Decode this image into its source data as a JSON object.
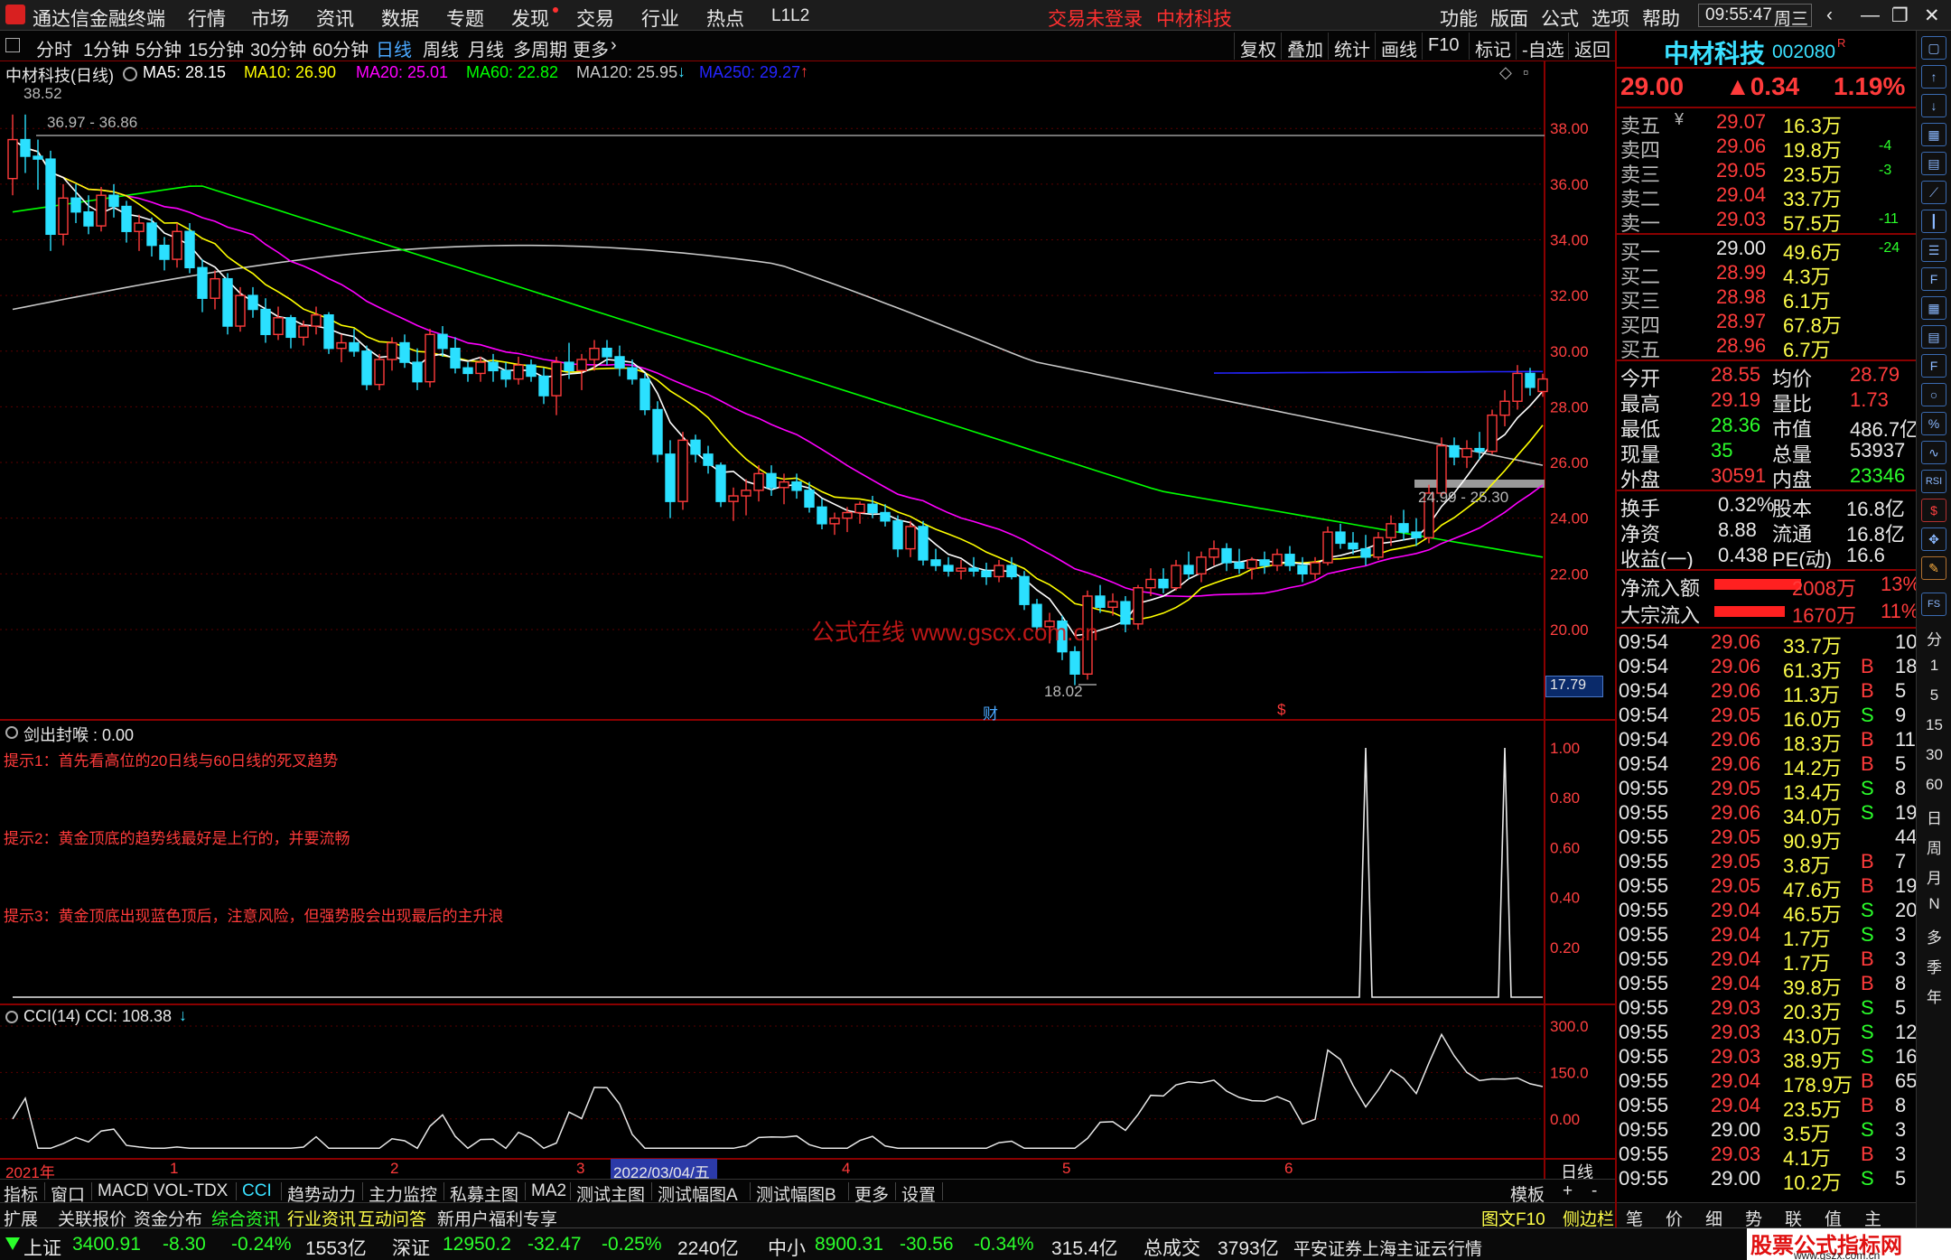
{
  "titlebar": {
    "app_title": "通达信金融终端",
    "menu": [
      "行情",
      "市场",
      "资讯",
      "数据",
      "专题",
      "发现",
      "交易",
      "行业",
      "热点",
      "L1L2"
    ],
    "login_status": "交易未登录",
    "stock_name": "中材科技",
    "right_menu": [
      "功能",
      "版面",
      "公式",
      "选项",
      "帮助"
    ],
    "clock": "09:55:47",
    "weekday": "周三"
  },
  "period_bar": {
    "items": [
      "分时",
      "1分钟",
      "5分钟",
      "15分钟",
      "30分钟",
      "60分钟",
      "日线",
      "周线",
      "月线",
      "多周期",
      "更多"
    ],
    "selected": "日线",
    "right_buttons": [
      "复权",
      "叠加",
      "统计",
      "画线",
      "F10",
      "标记",
      "-自选",
      "返回"
    ]
  },
  "main_chart": {
    "title": "中材科技(日线)",
    "ma_labels": [
      {
        "text": "MA5: 28.15",
        "color": "#ffffff"
      },
      {
        "text": "MA10: 26.90",
        "color": "#ffff00"
      },
      {
        "text": "MA20: 25.01",
        "color": "#ff00ff"
      },
      {
        "text": "MA60: 22.82",
        "color": "#00ff00"
      },
      {
        "text": "MA120: 25.95",
        "color": "#c8c8c8"
      },
      {
        "text": "MA250: 29.27",
        "color": "#2424ff"
      }
    ],
    "ma120_arrow": "↓",
    "ma250_arrow": "↑",
    "high_label": "38.52",
    "range_label_top": "36.97 - 36.86",
    "range_label_right": "24.99 - 25.30",
    "low_label": "18.02",
    "current_price_box": "17.79",
    "watermark": "公式在线 www.gscx.com.cn",
    "marker_cai": "财",
    "marker_dollar": "$",
    "y_ticks": [
      "38.00",
      "36.00",
      "34.00",
      "32.00",
      "30.00",
      "28.00",
      "26.00",
      "24.00",
      "22.00",
      "20.00"
    ]
  },
  "indicator1": {
    "title": "剑出封喉 : 0.00",
    "hints": [
      "提示1：首先看高位的20日线与60日线的死叉趋势",
      "提示2：黄金顶底的趋势线最好是上行的，并要流畅",
      "提示3：黄金顶底出现蓝色顶后，注意风险，但强势股会出现最后的主升浪"
    ],
    "y_ticks": [
      "1.00",
      "0.80",
      "0.60",
      "0.40",
      "0.20"
    ]
  },
  "indicator2": {
    "title": "CCI(14)  CCI: 108.38",
    "arrow": "↓",
    "y_ticks": [
      "300.0",
      "150.0",
      "0.00"
    ]
  },
  "x_axis": {
    "labels": [
      "2021年",
      "1",
      "2",
      "3",
      "2022/03/04/五",
      "4",
      "5",
      "6"
    ],
    "period": "日线"
  },
  "tabbar": {
    "tabs": [
      "指标",
      "窗口",
      "MACD",
      "VOL-TDX",
      "CCI",
      "趋势动力",
      "主力监控",
      "私募主图",
      "MA2",
      "测试主图",
      "测试幅图A",
      "测试幅图B",
      "更多",
      "设置"
    ],
    "right": [
      "模板",
      "+",
      "-"
    ]
  },
  "extbar": {
    "items": [
      "扩展",
      "关联报价",
      "资金分布",
      "综合资讯",
      "行业资讯",
      "互动问答",
      "新用户福利专享"
    ],
    "right_items": [
      "图文F10",
      "侧边栏",
      "笔",
      "价",
      "细",
      "势",
      "联",
      "值",
      "主"
    ]
  },
  "quote": {
    "name": "中材科技",
    "code": "002080",
    "code_mark": "R",
    "price": "29.00",
    "change": "▲0.34",
    "change_pct": "1.19%",
    "asks": [
      {
        "label": "卖五",
        "price": "29.07",
        "vol": "16.3万",
        "delta": ""
      },
      {
        "label": "卖四",
        "price": "29.06",
        "vol": "19.8万",
        "delta": "-4"
      },
      {
        "label": "卖三",
        "price": "29.05",
        "vol": "23.5万",
        "delta": "-3"
      },
      {
        "label": "卖二",
        "price": "29.04",
        "vol": "33.7万",
        "delta": ""
      },
      {
        "label": "卖一",
        "price": "29.03",
        "vol": "57.5万",
        "delta": "-11"
      }
    ],
    "bids": [
      {
        "label": "买一",
        "price": "29.00",
        "vol": "49.6万",
        "delta": "-24"
      },
      {
        "label": "买二",
        "price": "28.99",
        "vol": "4.3万",
        "delta": ""
      },
      {
        "label": "买三",
        "price": "28.98",
        "vol": "6.1万",
        "delta": ""
      },
      {
        "label": "买四",
        "price": "28.97",
        "vol": "67.8万",
        "delta": ""
      },
      {
        "label": "买五",
        "price": "28.96",
        "vol": "6.7万",
        "delta": ""
      }
    ],
    "stats": [
      {
        "l1": "今开",
        "v1": "28.55",
        "c1": "red",
        "l2": "均价",
        "v2": "28.79",
        "c2": "red"
      },
      {
        "l1": "最高",
        "v1": "29.19",
        "c1": "red",
        "l2": "量比",
        "v2": "1.73",
        "c2": "red"
      },
      {
        "l1": "最低",
        "v1": "28.36",
        "c1": "grn",
        "l2": "市值",
        "v2": "486.7亿",
        "c2": "wht"
      },
      {
        "l1": "现量",
        "v1": "35",
        "c1": "grn",
        "l2": "总量",
        "v2": "53937",
        "c2": "wht"
      },
      {
        "l1": "外盘",
        "v1": "30591",
        "c1": "red",
        "l2": "内盘",
        "v2": "23346",
        "c2": "grn"
      }
    ],
    "stats2": [
      {
        "l1": "换手",
        "v1": "0.32%",
        "l2": "股本",
        "v2": "16.8亿"
      },
      {
        "l1": "净资",
        "v1": "8.88",
        "l2": "流通",
        "v2": "16.8亿"
      },
      {
        "l1": "收益(一)",
        "v1": "0.438",
        "l2": "PE(动)",
        "v2": "16.6"
      }
    ],
    "flows": [
      {
        "label": "净流入额",
        "value": "2008万",
        "pct": "13%"
      },
      {
        "label": "大宗流入",
        "value": "1670万",
        "pct": "11%"
      }
    ],
    "ticks": [
      {
        "t": "09:54",
        "p": "29.06",
        "v": "33.7万",
        "d": "",
        "n": "10"
      },
      {
        "t": "09:54",
        "p": "29.06",
        "v": "61.3万",
        "d": "B",
        "n": "18"
      },
      {
        "t": "09:54",
        "p": "29.06",
        "v": "11.3万",
        "d": "B",
        "n": "5"
      },
      {
        "t": "09:54",
        "p": "29.05",
        "v": "16.0万",
        "d": "S",
        "n": "9"
      },
      {
        "t": "09:54",
        "p": "29.06",
        "v": "18.3万",
        "d": "B",
        "n": "11"
      },
      {
        "t": "09:54",
        "p": "29.06",
        "v": "14.2万",
        "d": "B",
        "n": "5"
      },
      {
        "t": "09:55",
        "p": "29.05",
        "v": "13.4万",
        "d": "S",
        "n": "8"
      },
      {
        "t": "09:55",
        "p": "29.06",
        "v": "34.0万",
        "d": "S",
        "n": "19"
      },
      {
        "t": "09:55",
        "p": "29.05",
        "v": "90.9万",
        "d": "",
        "n": "44"
      },
      {
        "t": "09:55",
        "p": "29.05",
        "v": "3.8万",
        "d": "B",
        "n": "7"
      },
      {
        "t": "09:55",
        "p": "29.05",
        "v": "47.6万",
        "d": "B",
        "n": "19"
      },
      {
        "t": "09:55",
        "p": "29.04",
        "v": "46.5万",
        "d": "S",
        "n": "20"
      },
      {
        "t": "09:55",
        "p": "29.04",
        "v": "1.7万",
        "d": "S",
        "n": "3"
      },
      {
        "t": "09:55",
        "p": "29.04",
        "v": "1.7万",
        "d": "B",
        "n": "3"
      },
      {
        "t": "09:55",
        "p": "29.04",
        "v": "39.8万",
        "d": "B",
        "n": "8"
      },
      {
        "t": "09:55",
        "p": "29.03",
        "v": "20.3万",
        "d": "S",
        "n": "5"
      },
      {
        "t": "09:55",
        "p": "29.03",
        "v": "43.0万",
        "d": "S",
        "n": "12"
      },
      {
        "t": "09:55",
        "p": "29.03",
        "v": "38.9万",
        "d": "S",
        "n": "16"
      },
      {
        "t": "09:55",
        "p": "29.04",
        "v": "178.9万",
        "d": "B",
        "n": "65"
      },
      {
        "t": "09:55",
        "p": "29.04",
        "v": "23.5万",
        "d": "B",
        "n": "8"
      },
      {
        "t": "09:55",
        "p": "29.00",
        "v": "3.5万",
        "d": "S",
        "n": "3"
      },
      {
        "t": "09:55",
        "p": "29.03",
        "v": "4.1万",
        "d": "B",
        "n": "3"
      },
      {
        "t": "09:55",
        "p": "29.00",
        "v": "10.2万",
        "d": "S",
        "n": "5"
      }
    ]
  },
  "sidebar": {
    "text_items": [
      "分",
      "1",
      "5",
      "15",
      "30",
      "60",
      "日",
      "周",
      "月",
      "N",
      "多",
      "季",
      "年"
    ]
  },
  "statusbar": {
    "sh_label": "上证",
    "sh_val": "3400.91",
    "sh_chg": "-8.30",
    "sh_pct": "-0.24%",
    "sh_amt": "1553亿",
    "sz_label": "深证",
    "sz_val": "12950.2",
    "sz_chg": "-32.47",
    "sz_pct": "-0.25%",
    "sz_amt": "2240亿",
    "zx_label": "中小",
    "zx_val": "8900.31",
    "zx_chg": "-30.56",
    "zx_pct": "-0.34%",
    "zx_amt": "315.4亿",
    "total_label": "总成交",
    "total_amt": "3793亿",
    "broker": "平安证券上海主证云行情",
    "logo_text": "股票公式指标网",
    "logo_url": "www.gszx.com.cn"
  },
  "chart_data": {
    "type": "candlestick",
    "title": "中材科技(日线)",
    "ylim": [
      17.5,
      39.5
    ],
    "candles": [
      [
        36.2,
        38.5,
        35.6,
        37.6
      ],
      [
        37.6,
        38.5,
        36.4,
        37.0
      ],
      [
        37.0,
        37.6,
        35.8,
        36.9
      ],
      [
        36.9,
        37.2,
        33.6,
        34.2
      ],
      [
        34.2,
        36.0,
        33.8,
        35.5
      ],
      [
        35.5,
        36.0,
        34.6,
        35.0
      ],
      [
        35.0,
        35.6,
        34.2,
        34.5
      ],
      [
        34.5,
        35.9,
        34.3,
        35.6
      ],
      [
        35.6,
        36.0,
        34.8,
        35.2
      ],
      [
        35.2,
        35.4,
        33.9,
        34.3
      ],
      [
        34.3,
        34.9,
        33.6,
        34.6
      ],
      [
        34.6,
        34.8,
        33.4,
        33.8
      ],
      [
        33.8,
        34.1,
        32.9,
        33.3
      ],
      [
        33.3,
        34.6,
        33.0,
        34.3
      ],
      [
        34.3,
        34.6,
        32.8,
        33.0
      ],
      [
        33.0,
        33.3,
        31.4,
        31.9
      ],
      [
        31.9,
        32.9,
        31.5,
        32.6
      ],
      [
        32.6,
        32.8,
        30.6,
        30.9
      ],
      [
        30.9,
        32.3,
        30.7,
        32.0
      ],
      [
        32.0,
        32.3,
        31.2,
        31.5
      ],
      [
        31.5,
        31.9,
        30.3,
        30.6
      ],
      [
        30.6,
        31.6,
        30.4,
        31.2
      ],
      [
        31.2,
        31.3,
        30.1,
        30.5
      ],
      [
        30.5,
        31.1,
        30.2,
        30.9
      ],
      [
        30.9,
        31.6,
        30.6,
        31.3
      ],
      [
        31.3,
        31.4,
        29.9,
        30.1
      ],
      [
        30.1,
        30.6,
        29.6,
        30.3
      ],
      [
        30.3,
        30.8,
        29.8,
        30.0
      ],
      [
        30.0,
        30.2,
        28.6,
        28.8
      ],
      [
        28.8,
        29.9,
        28.6,
        29.7
      ],
      [
        29.7,
        30.5,
        29.3,
        30.3
      ],
      [
        30.3,
        30.6,
        29.4,
        29.6
      ],
      [
        29.6,
        30.1,
        28.6,
        28.9
      ],
      [
        28.9,
        30.8,
        28.7,
        30.6
      ],
      [
        30.6,
        30.9,
        29.8,
        30.1
      ],
      [
        30.1,
        30.5,
        29.2,
        29.4
      ],
      [
        29.4,
        29.6,
        28.9,
        29.2
      ],
      [
        29.2,
        29.8,
        28.9,
        29.6
      ],
      [
        29.6,
        29.9,
        28.9,
        29.3
      ],
      [
        29.3,
        29.6,
        28.7,
        29.0
      ],
      [
        29.0,
        29.8,
        28.8,
        29.5
      ],
      [
        29.5,
        29.7,
        28.9,
        29.1
      ],
      [
        29.1,
        29.4,
        28.1,
        28.4
      ],
      [
        28.4,
        29.8,
        27.7,
        29.6
      ],
      [
        29.6,
        30.3,
        29.0,
        29.3
      ],
      [
        29.3,
        29.9,
        28.6,
        29.7
      ],
      [
        29.7,
        30.4,
        29.3,
        30.1
      ],
      [
        30.1,
        30.4,
        29.5,
        29.8
      ],
      [
        29.8,
        30.2,
        29.1,
        29.4
      ],
      [
        29.4,
        29.7,
        28.8,
        29.0
      ],
      [
        29.0,
        29.2,
        27.7,
        27.9
      ],
      [
        27.9,
        28.2,
        26.0,
        26.3
      ],
      [
        26.3,
        26.8,
        24.0,
        24.6
      ],
      [
        24.6,
        27.1,
        24.3,
        26.8
      ],
      [
        26.8,
        27.0,
        26.0,
        26.3
      ],
      [
        26.3,
        26.6,
        25.6,
        25.9
      ],
      [
        25.9,
        26.0,
        24.4,
        24.6
      ],
      [
        24.6,
        25.1,
        23.9,
        24.8
      ],
      [
        24.8,
        25.4,
        24.1,
        25.0
      ],
      [
        25.0,
        25.9,
        24.6,
        25.6
      ],
      [
        25.6,
        25.9,
        24.8,
        25.1
      ],
      [
        25.1,
        25.6,
        24.5,
        25.3
      ],
      [
        25.3,
        25.6,
        24.7,
        25.0
      ],
      [
        25.0,
        25.3,
        24.2,
        24.4
      ],
      [
        24.4,
        24.7,
        23.6,
        23.8
      ],
      [
        23.8,
        24.2,
        23.4,
        24.0
      ],
      [
        24.0,
        24.4,
        23.5,
        24.2
      ],
      [
        24.2,
        24.6,
        23.8,
        24.5
      ],
      [
        24.5,
        24.8,
        24.0,
        24.2
      ],
      [
        24.2,
        24.5,
        23.7,
        23.9
      ],
      [
        23.9,
        24.1,
        22.6,
        22.9
      ],
      [
        22.9,
        23.9,
        22.6,
        23.7
      ],
      [
        23.7,
        23.9,
        22.3,
        22.5
      ],
      [
        22.5,
        22.9,
        22.1,
        22.3
      ],
      [
        22.3,
        22.6,
        21.9,
        22.1
      ],
      [
        22.1,
        22.5,
        21.8,
        22.2
      ],
      [
        22.2,
        22.6,
        21.9,
        22.1
      ],
      [
        22.1,
        22.4,
        21.6,
        21.9
      ],
      [
        21.9,
        22.5,
        21.7,
        22.3
      ],
      [
        22.3,
        22.6,
        21.8,
        21.9
      ],
      [
        21.9,
        22.1,
        20.7,
        20.9
      ],
      [
        20.9,
        21.1,
        19.9,
        20.1
      ],
      [
        20.1,
        20.6,
        19.5,
        20.3
      ],
      [
        20.3,
        20.5,
        18.9,
        19.2
      ],
      [
        19.2,
        19.4,
        18.0,
        18.4
      ],
      [
        18.4,
        21.4,
        18.2,
        21.2
      ],
      [
        21.2,
        21.6,
        20.6,
        20.8
      ],
      [
        20.8,
        21.3,
        20.5,
        21.0
      ],
      [
        21.0,
        21.2,
        19.9,
        20.2
      ],
      [
        20.2,
        21.6,
        20.0,
        21.5
      ],
      [
        21.5,
        22.2,
        21.2,
        21.8
      ],
      [
        21.8,
        22.2,
        21.3,
        21.5
      ],
      [
        21.5,
        22.5,
        21.4,
        22.3
      ],
      [
        22.3,
        22.8,
        21.8,
        22.0
      ],
      [
        22.0,
        22.8,
        21.7,
        22.6
      ],
      [
        22.6,
        23.2,
        22.3,
        22.9
      ],
      [
        22.9,
        23.1,
        22.1,
        22.4
      ],
      [
        22.4,
        22.9,
        22.0,
        22.2
      ],
      [
        22.2,
        22.6,
        21.8,
        22.5
      ],
      [
        22.5,
        22.8,
        22.0,
        22.3
      ],
      [
        22.3,
        22.9,
        22.1,
        22.7
      ],
      [
        22.7,
        23.0,
        22.1,
        22.3
      ],
      [
        22.3,
        22.6,
        21.7,
        22.0
      ],
      [
        22.0,
        22.6,
        21.8,
        22.4
      ],
      [
        22.4,
        23.7,
        22.3,
        23.5
      ],
      [
        23.5,
        23.8,
        22.9,
        23.1
      ],
      [
        23.1,
        23.5,
        22.7,
        22.9
      ],
      [
        22.9,
        23.4,
        22.3,
        22.6
      ],
      [
        22.6,
        23.5,
        22.5,
        23.3
      ],
      [
        23.3,
        24.1,
        23.0,
        23.8
      ],
      [
        23.8,
        24.3,
        23.2,
        23.5
      ],
      [
        23.5,
        24.0,
        23.0,
        23.3
      ],
      [
        23.3,
        25.2,
        23.1,
        24.9
      ],
      [
        24.9,
        26.9,
        24.8,
        26.6
      ],
      [
        26.6,
        26.9,
        25.9,
        26.2
      ],
      [
        26.2,
        26.8,
        25.8,
        26.5
      ],
      [
        26.5,
        27.1,
        26.1,
        26.4
      ],
      [
        26.4,
        27.9,
        26.3,
        27.7
      ],
      [
        27.7,
        28.6,
        27.3,
        28.2
      ],
      [
        28.2,
        29.5,
        27.9,
        29.2
      ],
      [
        29.2,
        29.4,
        28.4,
        28.7
      ],
      [
        28.55,
        29.19,
        28.36,
        29.0
      ]
    ],
    "ma5_last": 28.15,
    "ma10_last": 26.9,
    "ma20_last": 25.01,
    "ma60_last": 22.82,
    "ma120_last": 25.95,
    "ma250_last": 29.27,
    "indicator1_values": {
      "ylim": [
        0,
        1
      ],
      "spike_indices": [
        107,
        118
      ],
      "value": 0.0
    },
    "cci_values": {
      "ylim": [
        -100,
        300
      ],
      "last": 108.38
    }
  }
}
